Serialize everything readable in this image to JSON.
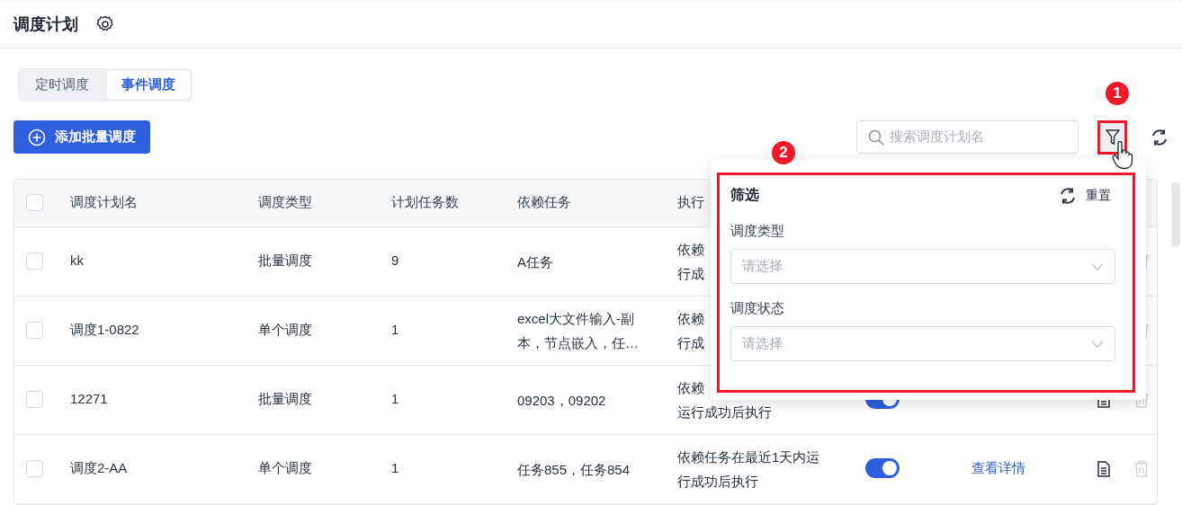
{
  "page": {
    "title": "调度计划"
  },
  "tabs": [
    {
      "label": "定时调度",
      "selected": false
    },
    {
      "label": "事件调度",
      "selected": true
    }
  ],
  "add_button": "添加批量调度",
  "search": {
    "placeholder": "搜索调度计划名"
  },
  "filter_button": {
    "annotation": "1",
    "highlighted": true
  },
  "table": {
    "all_checked": false,
    "columns": [
      "调度计划名",
      "调度类型",
      "计划任务数",
      "依赖任务",
      "执行"
    ],
    "rows": [
      {
        "checked": false,
        "name": "kk",
        "type": "批量调度",
        "count": "9",
        "dependency": "A任务",
        "condition": [
          "依赖",
          "行成"
        ]
      },
      {
        "checked": false,
        "name": "调度1-0822",
        "type": "单个调度",
        "count": "1",
        "dependency": "excel大文件输入-副本，节点嵌入，任…",
        "condition": [
          "依赖",
          "行成"
        ]
      },
      {
        "checked": false,
        "name": "12271",
        "type": "批量调度",
        "count": "1",
        "dependency": "09203，09202",
        "condition": [
          "依赖",
          "运行成功后执行"
        ],
        "enabled": true
      },
      {
        "checked": false,
        "name": "调度2-AA",
        "type": "单个调度",
        "count": "1",
        "dependency": "任务855，任务854",
        "condition": [
          "依赖任务在最近1天内运",
          "行成功后执行"
        ],
        "enabled": true,
        "link": "查看详情"
      }
    ]
  },
  "filter_panel": {
    "annotation": "2",
    "highlighted": true,
    "title": "筛选",
    "reset": "重置",
    "fields": [
      {
        "label": "调度类型",
        "placeholder": "请选择"
      },
      {
        "label": "调度状态",
        "placeholder": "请选择"
      }
    ]
  }
}
